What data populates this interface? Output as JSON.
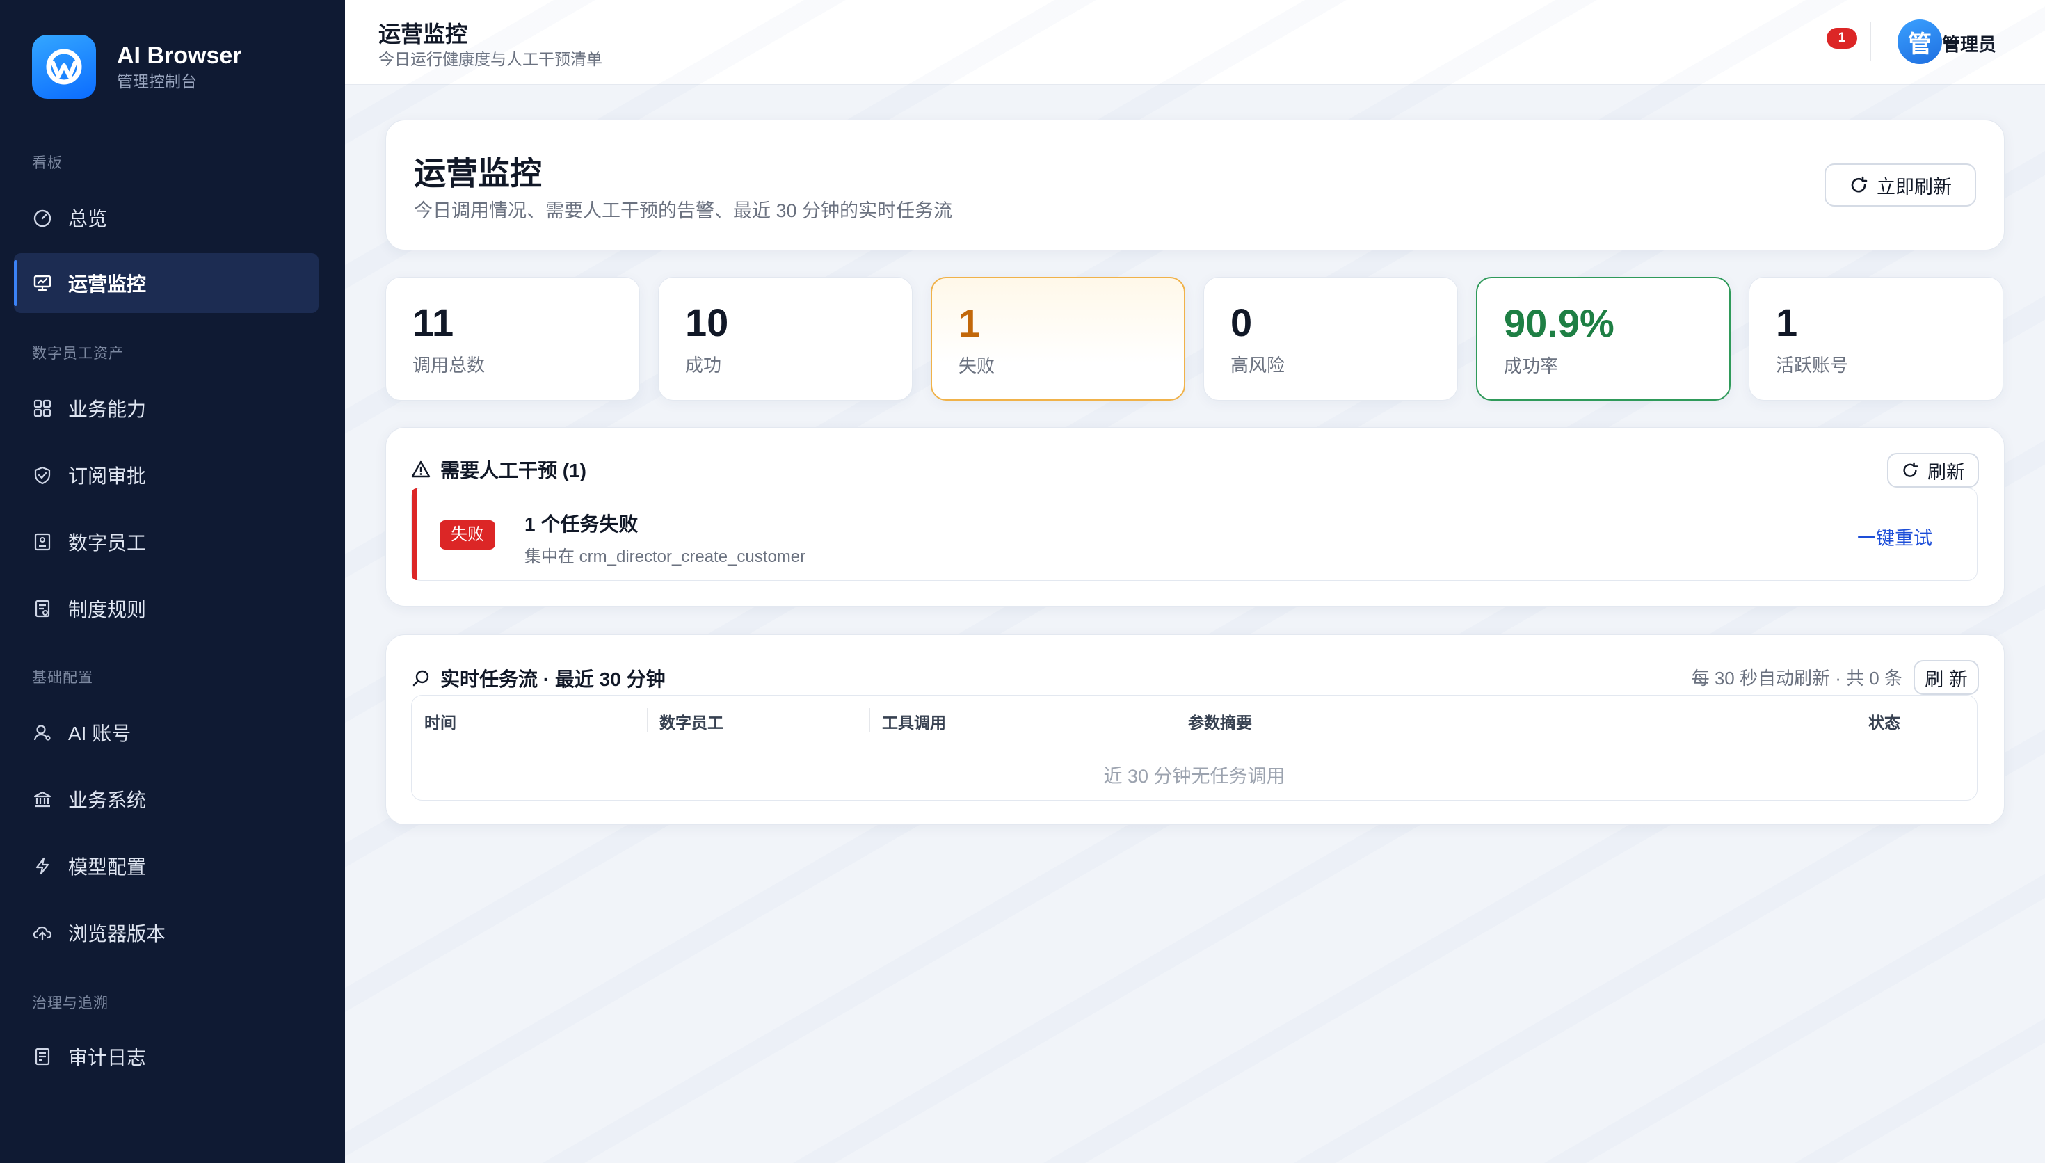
{
  "brand": {
    "title": "AI Browser",
    "subtitle": "管理控制台"
  },
  "sidebar": {
    "groups": [
      {
        "title": "看板",
        "items": [
          {
            "label": "总览",
            "icon": "dashboard-icon"
          },
          {
            "label": "运营监控",
            "icon": "monitor-icon",
            "active": true
          }
        ]
      },
      {
        "title": "数字员工资产",
        "items": [
          {
            "label": "业务能力",
            "icon": "grid-icon"
          },
          {
            "label": "订阅审批",
            "icon": "shield-check-icon"
          },
          {
            "label": "数字员工",
            "icon": "id-card-icon"
          },
          {
            "label": "制度规则",
            "icon": "document-icon"
          }
        ]
      },
      {
        "title": "基础配置",
        "items": [
          {
            "label": "AI 账号",
            "icon": "user-icon"
          },
          {
            "label": "业务系统",
            "icon": "bank-icon"
          },
          {
            "label": "模型配置",
            "icon": "bolt-icon"
          },
          {
            "label": "浏览器版本",
            "icon": "cloud-upload-icon"
          }
        ]
      },
      {
        "title": "治理与追溯",
        "items": [
          {
            "label": "审计日志",
            "icon": "audit-log-icon"
          }
        ]
      }
    ]
  },
  "header": {
    "title": "运营监控",
    "subtitle": "今日运行健康度与人工干预清单",
    "notification_count": "1",
    "avatar_text": "管",
    "user_name": "管理员"
  },
  "hero": {
    "title": "运营监控",
    "subtitle": "今日调用情况、需要人工干预的告警、最近 30 分钟的实时任务流",
    "refresh_label": "立即刷新"
  },
  "stats": [
    {
      "value": "11",
      "label": "调用总数",
      "variant": "default"
    },
    {
      "value": "10",
      "label": "成功",
      "variant": "default"
    },
    {
      "value": "1",
      "label": "失败",
      "variant": "warn"
    },
    {
      "value": "0",
      "label": "高风险",
      "variant": "default"
    },
    {
      "value": "90.9%",
      "label": "成功率",
      "variant": "ok"
    },
    {
      "value": "1",
      "label": "活跃账号",
      "variant": "default"
    }
  ],
  "intervention": {
    "title": "需要人工干预 (1)",
    "refresh_label": "刷新",
    "alerts": [
      {
        "badge": "失败",
        "title": "1 个任务失败",
        "detail": "集中在 crm_director_create_customer",
        "action": "一键重试"
      }
    ]
  },
  "task_stream": {
    "title": "实时任务流 · 最近 30 分钟",
    "auto_note": "每 30 秒自动刷新 · 共 0 条",
    "refresh_label": "刷 新",
    "columns": [
      "时间",
      "数字员工",
      "工具调用",
      "参数摘要",
      "状态"
    ],
    "empty_text": "近 30 分钟无任务调用"
  },
  "colors": {
    "sidebar_bg": "#0f1a33",
    "accent": "#1d4ed8",
    "danger": "#dc2626",
    "warning": "#f0b24a",
    "success": "#1e7f44"
  }
}
